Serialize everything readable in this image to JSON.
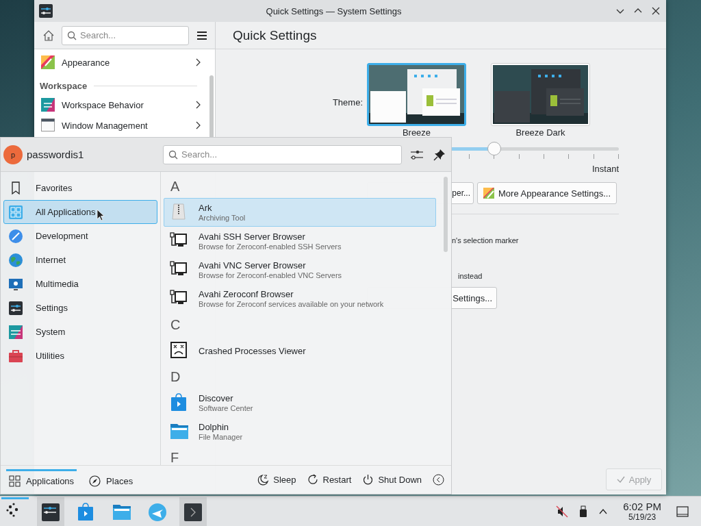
{
  "settings_window": {
    "title": "Quick Settings — System Settings",
    "search": {
      "placeholder": "Search..."
    },
    "sidebar": {
      "items": [
        {
          "kind": "item",
          "label": "Appearance"
        },
        {
          "kind": "heading",
          "label": "Workspace"
        },
        {
          "kind": "item",
          "label": "Workspace Behavior"
        },
        {
          "kind": "item",
          "label": "Window Management"
        }
      ]
    },
    "page_title": "Quick Settings",
    "theme_label": "Theme:",
    "themes": [
      {
        "kind": "light",
        "name": "Breeze",
        "selected": true
      },
      {
        "kind": "dark",
        "name": "Breeze Dark",
        "selected": false
      }
    ],
    "animation_slider": {
      "level": 0.49,
      "max_label": "Instant"
    },
    "wallpaper_button_visible_part": "per...",
    "appearance_button": "More Appearance Settings...",
    "selection_hint_visible_part": "n's selection marker",
    "double_click_hint_visible_part": "instead",
    "behavior_button_visible_part": "Settings...",
    "apply_button": {
      "label": "Apply",
      "disabled": true
    }
  },
  "launcher": {
    "avatar_letter": "p",
    "user": "passwordis1",
    "search": {
      "placeholder": "Search..."
    },
    "categories": [
      {
        "label": "Favorites",
        "selected": false
      },
      {
        "label": "All Applications",
        "selected": true
      },
      {
        "label": "Development",
        "selected": false
      },
      {
        "label": "Internet",
        "selected": false
      },
      {
        "label": "Multimedia",
        "selected": false
      },
      {
        "label": "Settings",
        "selected": false
      },
      {
        "label": "System",
        "selected": false
      },
      {
        "label": "Utilities",
        "selected": false
      }
    ],
    "sections": [
      {
        "letter": "A",
        "apps": [
          {
            "name": "Ark",
            "description": "Archiving Tool",
            "selected": true
          },
          {
            "name": "Avahi SSH Server Browser",
            "description": "Browse for Zeroconf-enabled SSH Servers",
            "selected": false
          },
          {
            "name": "Avahi VNC Server Browser",
            "description": "Browse for Zeroconf-enabled VNC Servers",
            "selected": false
          },
          {
            "name": "Avahi Zeroconf Browser",
            "description": "Browse for Zeroconf services available on your network",
            "selected": false
          }
        ]
      },
      {
        "letter": "C",
        "apps": [
          {
            "name": "Crashed Processes Viewer",
            "selected": false
          }
        ]
      },
      {
        "letter": "D",
        "apps": [
          {
            "name": "Discover",
            "description": "Software Center",
            "selected": false
          },
          {
            "name": "Dolphin",
            "description": "File Manager",
            "selected": false
          }
        ]
      },
      {
        "letter": "F"
      }
    ],
    "tabs": [
      {
        "label": "Applications",
        "selected": true
      },
      {
        "label": "Places",
        "selected": false
      }
    ],
    "power_actions": [
      {
        "label": "Sleep"
      },
      {
        "label": "Restart"
      },
      {
        "label": "Shut Down"
      }
    ]
  },
  "taskbar": {
    "tasks": [
      {
        "active": true
      },
      {
        "active": true
      },
      {
        "active": false
      },
      {
        "active": false
      },
      {
        "active": false
      },
      {
        "active": true
      }
    ],
    "clock": {
      "time": "6:02 PM",
      "date": "5/19/23"
    }
  }
}
